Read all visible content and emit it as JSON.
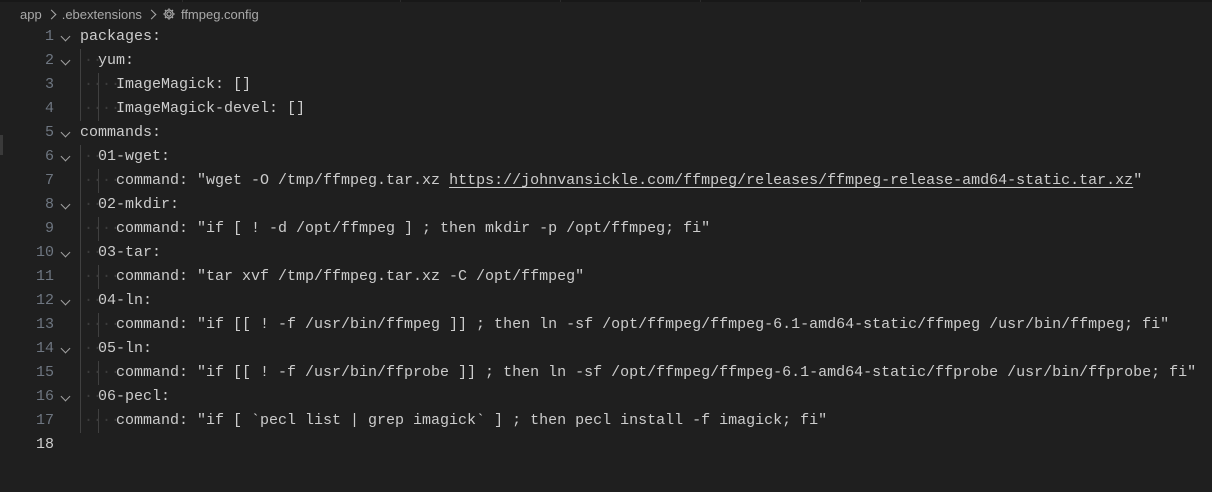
{
  "breadcrumb": {
    "items": [
      "app",
      ".ebextensions",
      "ffmpeg.config"
    ],
    "file_icon": "gear-icon"
  },
  "editor": {
    "lines": [
      {
        "num": "1",
        "indent": 0,
        "fold": true,
        "text": "packages:"
      },
      {
        "num": "2",
        "indent": 1,
        "fold": true,
        "text": "yum:"
      },
      {
        "num": "3",
        "indent": 2,
        "fold": false,
        "text": "ImageMagick: []"
      },
      {
        "num": "4",
        "indent": 2,
        "fold": false,
        "text": "ImageMagick-devel: []"
      },
      {
        "num": "5",
        "indent": 0,
        "fold": true,
        "text": "commands:"
      },
      {
        "num": "6",
        "indent": 1,
        "fold": true,
        "text": "01-wget:"
      },
      {
        "num": "7",
        "indent": 2,
        "fold": false,
        "text": "command: \"wget -O /tmp/ffmpeg.tar.xz ",
        "link": "https://johnvansickle.com/ffmpeg/releases/ffmpeg-release-amd64-static.tar.xz",
        "after": "\""
      },
      {
        "num": "8",
        "indent": 1,
        "fold": true,
        "text": "02-mkdir:"
      },
      {
        "num": "9",
        "indent": 2,
        "fold": false,
        "text": "command: \"if [ ! -d /opt/ffmpeg ] ; then mkdir -p /opt/ffmpeg; fi\""
      },
      {
        "num": "10",
        "indent": 1,
        "fold": true,
        "text": "03-tar:"
      },
      {
        "num": "11",
        "indent": 2,
        "fold": false,
        "text": "command: \"tar xvf /tmp/ffmpeg.tar.xz -C /opt/ffmpeg\""
      },
      {
        "num": "12",
        "indent": 1,
        "fold": true,
        "text": "04-ln:"
      },
      {
        "num": "13",
        "indent": 2,
        "fold": false,
        "text": "command: \"if [[ ! -f /usr/bin/ffmpeg ]] ; then ln -sf /opt/ffmpeg/ffmpeg-6.1-amd64-static/ffmpeg /usr/bin/ffmpeg; fi\""
      },
      {
        "num": "14",
        "indent": 1,
        "fold": true,
        "text": "05-ln:"
      },
      {
        "num": "15",
        "indent": 2,
        "fold": false,
        "text": "command: \"if [[ ! -f /usr/bin/ffprobe ]] ; then ln -sf /opt/ffmpeg/ffmpeg-6.1-amd64-static/ffprobe /usr/bin/ffprobe; fi\""
      },
      {
        "num": "16",
        "indent": 1,
        "fold": true,
        "text": "06-pecl:"
      },
      {
        "num": "17",
        "indent": 2,
        "fold": false,
        "text": "command: \"if [ `pecl list | grep imagick` ] ; then pecl install -f imagick; fi\""
      },
      {
        "num": "18",
        "indent": 0,
        "fold": false,
        "text": "",
        "active": true
      }
    ]
  },
  "colors": {
    "background": "#1f1f1f",
    "text": "#cccccc",
    "line_number": "#6e7681",
    "indent_guide": "#404040"
  }
}
